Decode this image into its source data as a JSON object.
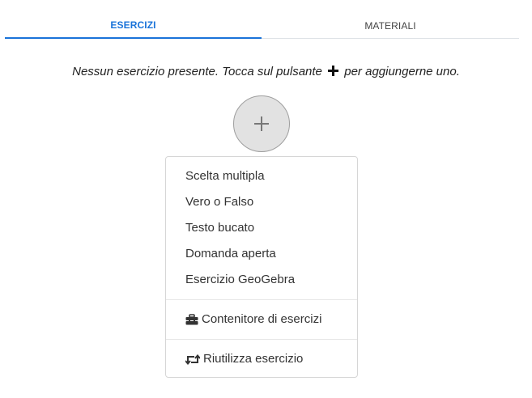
{
  "tabs": [
    {
      "label": "ESERCIZI",
      "active": true
    },
    {
      "label": "MATERIALI",
      "active": false
    }
  ],
  "empty_message": {
    "before": "Nessun esercizio presente. Tocca sul pulsante",
    "after": "per aggiungerne uno."
  },
  "add_button": {
    "icon": "plus-icon"
  },
  "menu": {
    "items": [
      {
        "label": "Scelta multipla"
      },
      {
        "label": "Vero o Falso"
      },
      {
        "label": "Testo bucato"
      },
      {
        "label": "Domanda aperta"
      },
      {
        "label": "Esercizio GeoGebra"
      }
    ],
    "container_item": {
      "label": "Contenitore di esercizi",
      "icon": "toolbox-icon"
    },
    "reuse_item": {
      "label": "Riutilizza esercizio",
      "icon": "retweet-icon"
    }
  },
  "colors": {
    "accent": "#1a73d9",
    "button_bg": "#e2e2e2"
  }
}
